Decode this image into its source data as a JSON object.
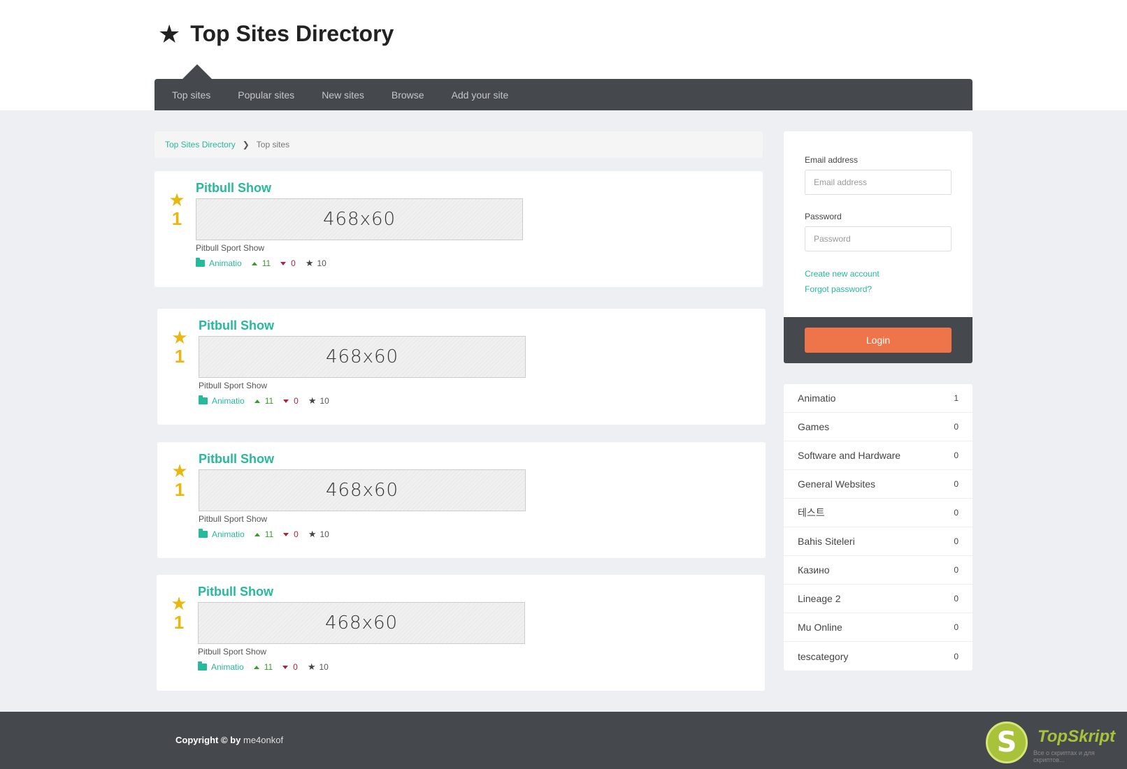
{
  "header": {
    "brand_icon": "star-icon",
    "title": "Top Sites Directory"
  },
  "nav": {
    "items": [
      "Top sites",
      "Popular sites",
      "New sites",
      "Browse",
      "Add your site"
    ],
    "active": "Top sites"
  },
  "breadcrumb": {
    "home": "Top Sites Directory",
    "separator": "❯",
    "current": "Top sites"
  },
  "sites": [
    {
      "rank": "1",
      "name": "Pitbull Show",
      "banner": "468x60",
      "description": "Pitbull Sport Show",
      "category": "Animatio",
      "votes_up": "11",
      "votes_down": "0",
      "rating": "10"
    },
    {
      "rank": "1",
      "name": "Pitbull Show",
      "banner": "468x60",
      "description": "Pitbull Sport Show",
      "category": "Animatio",
      "votes_up": "11",
      "votes_down": "0",
      "rating": "10"
    },
    {
      "rank": "1",
      "name": "Pitbull Show",
      "banner": "468x60",
      "description": "Pitbull Sport Show",
      "category": "Animatio",
      "votes_up": "11",
      "votes_down": "0",
      "rating": "10"
    },
    {
      "rank": "1",
      "name": "Pitbull Show",
      "banner": "468x60",
      "description": "Pitbull Sport Show",
      "category": "Animatio",
      "votes_up": "11",
      "votes_down": "0",
      "rating": "10"
    }
  ],
  "login": {
    "email_label": "Email address",
    "email_placeholder": "Email address",
    "password_label": "Password",
    "password_placeholder": "Password",
    "create_account": "Create new account",
    "forgot_password": "Forgot password?",
    "login_button": "Login"
  },
  "categories": [
    {
      "name": "Animatio",
      "count": "1"
    },
    {
      "name": "Games",
      "count": "0"
    },
    {
      "name": "Software and Hardware",
      "count": "0"
    },
    {
      "name": "General Websites",
      "count": "0"
    },
    {
      "name": "테스트",
      "count": "0"
    },
    {
      "name": "Bahis Siteleri",
      "count": "0"
    },
    {
      "name": "Казино",
      "count": "0"
    },
    {
      "name": "Lineage 2",
      "count": "0"
    },
    {
      "name": "Mu Online",
      "count": "0"
    },
    {
      "name": "tescategory",
      "count": "0"
    }
  ],
  "footer": {
    "copyright": "Copyright © by",
    "author": "me4onkof",
    "logo_letter": "S",
    "logo_text": "TopSkript",
    "logo_sub": "Все о скриптах и для скриптов..."
  },
  "colors": {
    "accent": "#26b99a",
    "nav_bg": "#45494e",
    "login_button": "#ee7449",
    "rank_gold": "#e8b810"
  }
}
